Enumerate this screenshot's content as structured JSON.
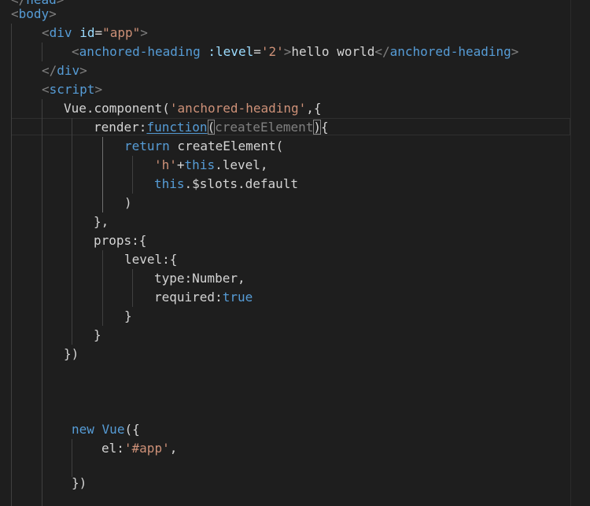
{
  "editor": {
    "theme": {
      "background": "#1e1e1e",
      "keyword": "#569cd6",
      "string": "#ce9178",
      "text": "#d4d4d4",
      "punctuation": "#808080"
    },
    "lines": [
      [
        {
          "t": "</",
          "c": "br"
        },
        {
          "t": "head",
          "c": "tag"
        },
        {
          "t": ">",
          "c": "br"
        }
      ],
      [
        {
          "t": "<",
          "c": "br"
        },
        {
          "t": "body",
          "c": "tag"
        },
        {
          "t": ">",
          "c": "br"
        }
      ],
      [
        {
          "t": "<",
          "c": "br"
        },
        {
          "t": "div",
          "c": "tag"
        },
        {
          "t": " ",
          "c": "txt"
        },
        {
          "t": "id",
          "c": "attr"
        },
        {
          "t": "=",
          "c": "txt"
        },
        {
          "t": "\"app\"",
          "c": "str"
        },
        {
          "t": ">",
          "c": "br"
        }
      ],
      [
        {
          "t": "<",
          "c": "br"
        },
        {
          "t": "anchored-heading",
          "c": "tag"
        },
        {
          "t": " ",
          "c": "txt"
        },
        {
          "t": ":level",
          "c": "attr"
        },
        {
          "t": "=",
          "c": "txt"
        },
        {
          "t": "'2'",
          "c": "str"
        },
        {
          "t": ">",
          "c": "br"
        },
        {
          "t": "hello world",
          "c": "txt"
        },
        {
          "t": "</",
          "c": "br"
        },
        {
          "t": "anchored-heading",
          "c": "tag"
        },
        {
          "t": ">",
          "c": "br"
        }
      ],
      [
        {
          "t": "</",
          "c": "br"
        },
        {
          "t": "div",
          "c": "tag"
        },
        {
          "t": ">",
          "c": "br"
        }
      ],
      [
        {
          "t": "<",
          "c": "br"
        },
        {
          "t": "script",
          "c": "tag"
        },
        {
          "t": ">",
          "c": "br"
        }
      ],
      [
        {
          "t": "Vue.component(",
          "c": "txt"
        },
        {
          "t": "'anchored-heading'",
          "c": "str"
        },
        {
          "t": ",{",
          "c": "txt"
        }
      ],
      [
        {
          "t": "render:",
          "c": "txt"
        },
        {
          "t": "function",
          "c": "kw ul"
        },
        {
          "t": "(",
          "c": "txt box"
        },
        {
          "t": "createElement",
          "c": "prm"
        },
        {
          "t": ")",
          "c": "txt box"
        },
        {
          "t": "{",
          "c": "txt"
        }
      ],
      [
        {
          "t": "return",
          "c": "kw"
        },
        {
          "t": " createElement(",
          "c": "txt"
        }
      ],
      [
        {
          "t": "'h'",
          "c": "str"
        },
        {
          "t": "+",
          "c": "txt"
        },
        {
          "t": "this",
          "c": "kw"
        },
        {
          "t": ".level,",
          "c": "txt"
        }
      ],
      [
        {
          "t": "this",
          "c": "kw"
        },
        {
          "t": ".$slots.default",
          "c": "txt"
        }
      ],
      [
        {
          "t": ")",
          "c": "txt"
        }
      ],
      [
        {
          "t": "},",
          "c": "txt"
        }
      ],
      [
        {
          "t": "props:{",
          "c": "txt"
        }
      ],
      [
        {
          "t": "level:{",
          "c": "txt"
        }
      ],
      [
        {
          "t": "type:Number,",
          "c": "txt"
        }
      ],
      [
        {
          "t": "required:",
          "c": "txt"
        },
        {
          "t": "true",
          "c": "kw"
        }
      ],
      [
        {
          "t": "}",
          "c": "txt"
        }
      ],
      [
        {
          "t": "}",
          "c": "txt"
        }
      ],
      [
        {
          "t": "})",
          "c": "txt"
        }
      ],
      [],
      [],
      [
        {
          "t": "new",
          "c": "kw"
        },
        {
          "t": " ",
          "c": "txt"
        },
        {
          "t": "Vue",
          "c": "kw"
        },
        {
          "t": "({",
          "c": "txt"
        }
      ],
      [
        {
          "t": "el:",
          "c": "txt"
        },
        {
          "t": "'#app'",
          "c": "str"
        },
        {
          "t": ",",
          "c": "txt"
        }
      ],
      [],
      [
        {
          "t": "})",
          "c": "txt"
        }
      ]
    ]
  }
}
